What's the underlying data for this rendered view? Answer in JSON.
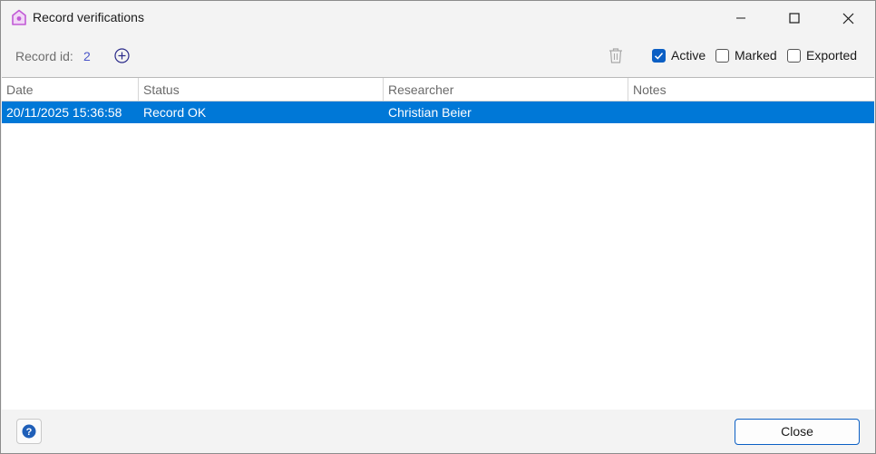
{
  "window": {
    "title": "Record verifications"
  },
  "toolbar": {
    "record_id_label": "Record id:",
    "record_id_value": "2",
    "filters": [
      {
        "label": "Active",
        "checked": true
      },
      {
        "label": "Marked",
        "checked": false
      },
      {
        "label": "Exported",
        "checked": false
      }
    ]
  },
  "table": {
    "columns": [
      "Date",
      "Status",
      "Researcher",
      "Notes"
    ],
    "rows": [
      {
        "date": "20/11/2025 15:36:58",
        "status": "Record OK",
        "researcher": "Christian Beier",
        "notes": ""
      }
    ],
    "selected_row_color": "#0078d7"
  },
  "footer": {
    "help_glyph": "?",
    "close_label": "Close"
  },
  "colors": {
    "accent": "#0b5fc4",
    "app_icon": "#c15ad6"
  }
}
